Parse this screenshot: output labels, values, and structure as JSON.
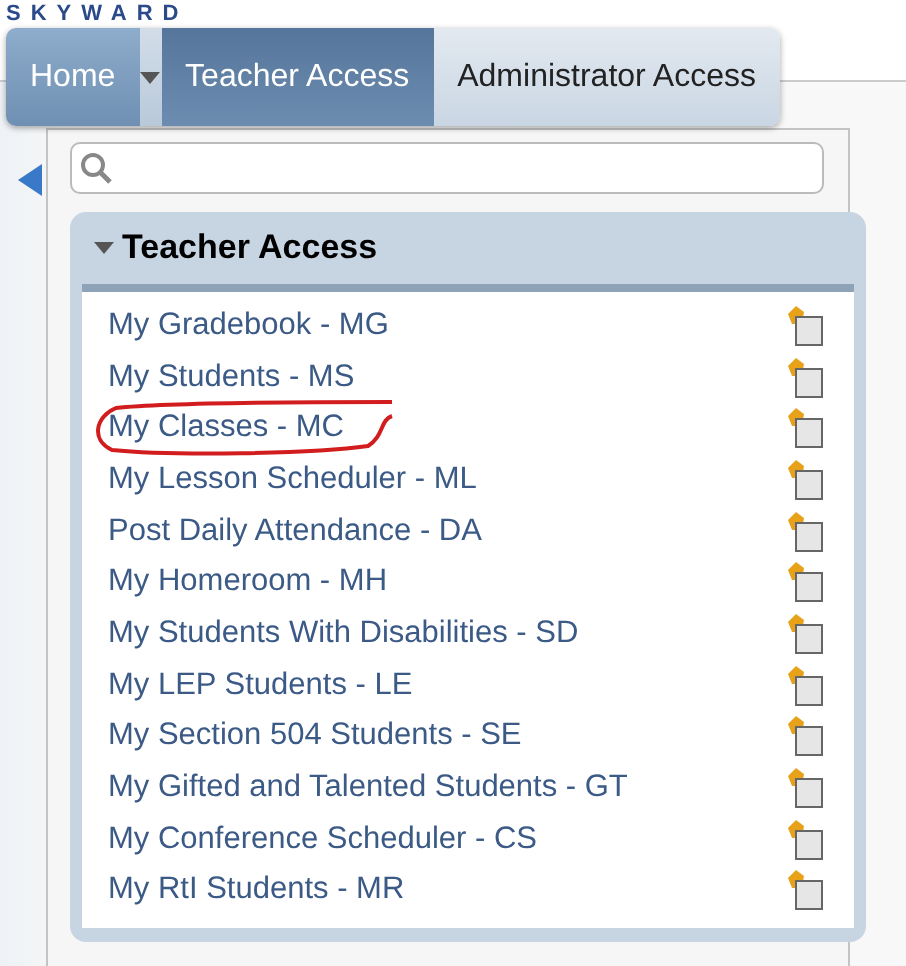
{
  "logo": "SKYWARD",
  "menu": [
    {
      "label": "Home",
      "kind": "tab",
      "selected": false
    },
    {
      "kind": "dropdown",
      "selected": false
    },
    {
      "label": "Teacher Access",
      "kind": "tab",
      "selected": true
    },
    {
      "label": "Administrator Access",
      "kind": "tab",
      "selected": false
    }
  ],
  "group": {
    "title": "Teacher Access",
    "expanded": true,
    "items": [
      {
        "label": "My Gradebook - MG",
        "circled": false
      },
      {
        "label": "My Students - MS",
        "circled": false
      },
      {
        "label": "My Classes - MC",
        "circled": true
      },
      {
        "label": "My Lesson Scheduler - ML",
        "circled": false
      },
      {
        "label": "Post Daily Attendance - DA",
        "circled": false
      },
      {
        "label": "My Homeroom - MH",
        "circled": false
      },
      {
        "label": "My Students With Disabilities - SD",
        "circled": false
      },
      {
        "label": "My LEP Students - LE",
        "circled": false
      },
      {
        "label": "My Section 504 Students - SE",
        "circled": false
      },
      {
        "label": "My Gifted and Talented Students - GT",
        "circled": false
      },
      {
        "label": "My Conference Scheduler - CS",
        "circled": false
      },
      {
        "label": "My RtI Students - MR",
        "circled": false
      }
    ]
  }
}
